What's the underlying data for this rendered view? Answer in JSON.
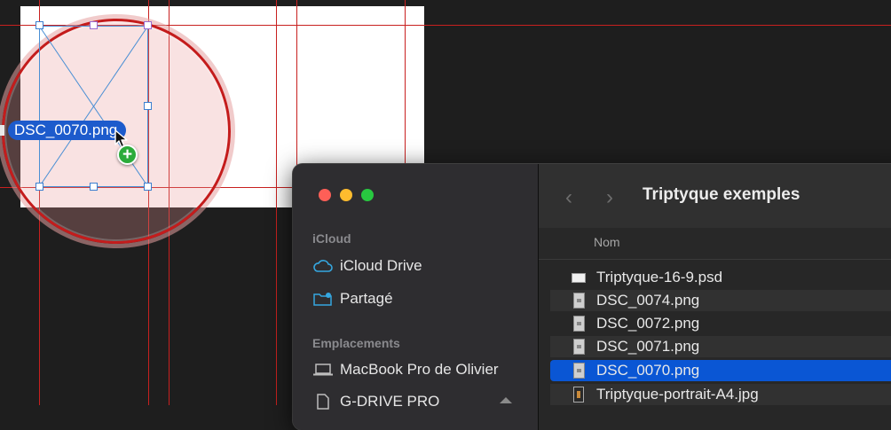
{
  "canvas": {
    "drag_filename": "DSC_0070.png",
    "add_badge": "+"
  },
  "finder": {
    "title": "Triptyque exemples",
    "back_glyph": "‹",
    "forward_glyph": "›",
    "column_header": "Nom",
    "sidebar": {
      "icloud_heading": "iCloud",
      "icloud_drive": "iCloud Drive",
      "shared": "Partagé",
      "locations_heading": "Emplacements",
      "macbook": "MacBook Pro de Olivier",
      "drive": "G-DRIVE PRO"
    },
    "files": [
      {
        "name": "Triptyque-16-9.psd",
        "icon": "psd-file-icon"
      },
      {
        "name": "DSC_0074.png",
        "icon": "png-file-icon"
      },
      {
        "name": "DSC_0072.png",
        "icon": "png-file-icon"
      },
      {
        "name": "DSC_0071.png",
        "icon": "png-file-icon"
      },
      {
        "name": "DSC_0070.png",
        "icon": "png-file-icon",
        "selected": true
      },
      {
        "name": "Triptyque-portrait-A4.jpg",
        "icon": "jpg-file-icon"
      }
    ]
  },
  "colors": {
    "guide": "#c8201f",
    "selection": "#0a56d4",
    "drag_label": "#1d5bcc",
    "add_badge": "#2bab3a"
  }
}
